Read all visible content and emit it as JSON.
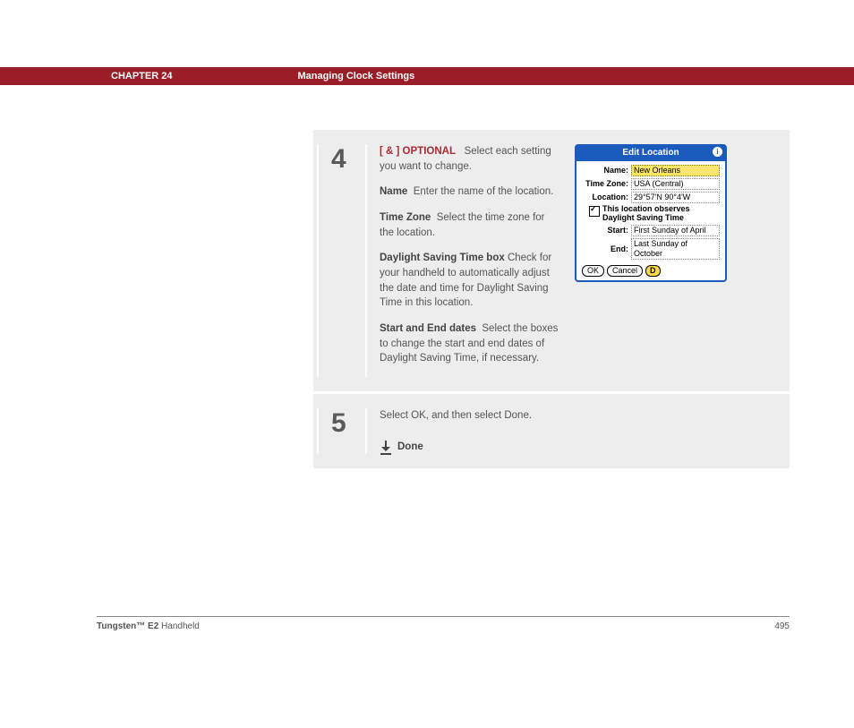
{
  "header": {
    "chapter": "CHAPTER 24",
    "title": "Managing Clock Settings"
  },
  "steps": [
    {
      "num": "4",
      "optional_marker": "[ & ]  OPTIONAL",
      "optional_text": "Select each setting you want to change.",
      "items": [
        {
          "label": "Name",
          "text": "Enter the name of the location."
        },
        {
          "label": "Time Zone",
          "text": "Select the time zone for the location."
        },
        {
          "label": "Daylight Saving Time box",
          "text": "Check for your handheld to automatically adjust the date and time for Daylight Saving Time in this location."
        },
        {
          "label": "Start and End dates",
          "text": "Select the boxes to change the start and end dates of Daylight Saving Time, if necessary."
        }
      ]
    },
    {
      "num": "5",
      "text": "Select OK, and then select Done.",
      "done": "Done"
    }
  ],
  "palm": {
    "title": "Edit Location",
    "info": "i",
    "name_label": "Name:",
    "name_value": "New Orleans",
    "tz_label": "Time Zone:",
    "tz_value": "USA (Central)",
    "loc_label": "Location:",
    "loc_value": "29°57'N 90°4'W",
    "dst_text": "This location observes Daylight Saving Time",
    "start_label": "Start:",
    "start_value": "First Sunday of April",
    "end_label": "End:",
    "end_value": "Last Sunday of October",
    "ok": "OK",
    "cancel": "Cancel",
    "help": "D"
  },
  "footer": {
    "product_bold": "Tungsten™ E2",
    "product_rest": " Handheld",
    "page": "495"
  }
}
